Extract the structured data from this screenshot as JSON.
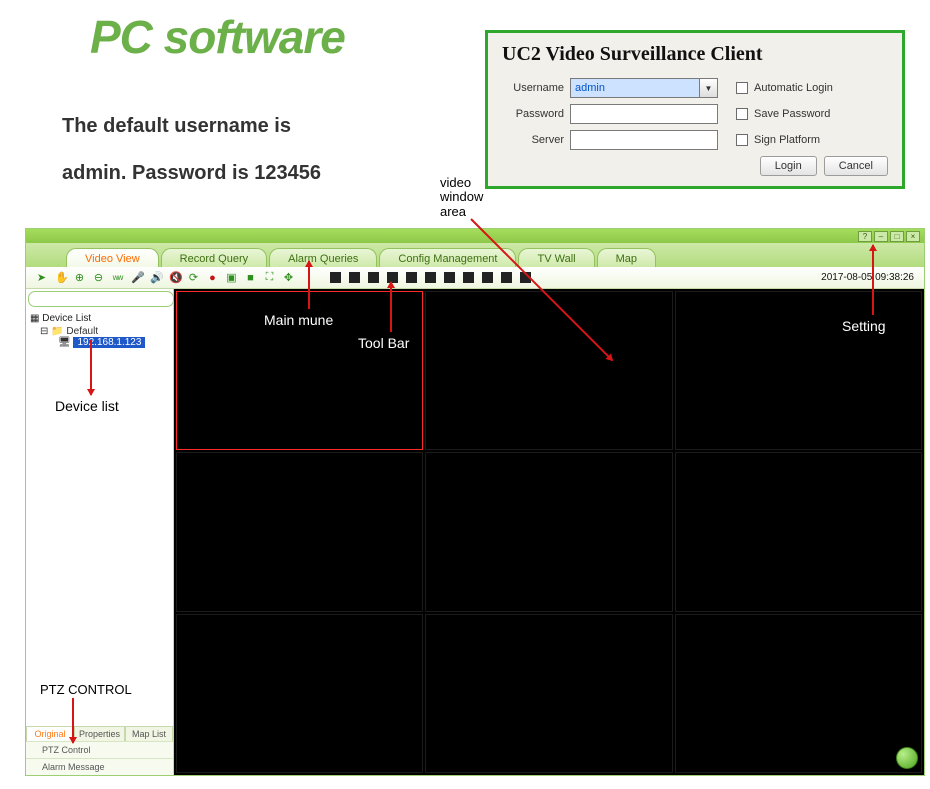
{
  "heading": "PC software",
  "subtext_line1": "The default username is",
  "subtext_line2": "admin. Password is 123456",
  "login": {
    "title": "UC2 Video Surveillance Client",
    "username_label": "Username",
    "password_label": "Password",
    "server_label": "Server",
    "username_value": "admin",
    "password_value": "",
    "server_value": "",
    "auto_login": "Automatic Login",
    "save_password": "Save Password",
    "sign_platform": "Sign Platform",
    "login_btn": "Login",
    "cancel_btn": "Cancel"
  },
  "tabs": {
    "video_view": "Video View",
    "record_query": "Record Query",
    "alarm_queries": "Alarm Queries",
    "config_mgmt": "Config Management",
    "tv_wall": "TV Wall",
    "map": "Map"
  },
  "toolbar": {
    "timestamp": "2017-08-05 09:38:26"
  },
  "sidebar": {
    "device_list_label": "Device List",
    "default_label": "Default",
    "selected_device": "192.168.1.123",
    "bottom_tabs": {
      "original": "Original",
      "properties": "Properties",
      "map_list": "Map List"
    },
    "footer": {
      "ptz": "PTZ Control",
      "alarm": "Alarm Message"
    }
  },
  "annotations": {
    "video_window_area": "video\nwindow\narea",
    "main_menu": "Main mune",
    "tool_bar": "Tool Bar",
    "setting": "Setting",
    "device_list": "Device list",
    "ptz_control": "PTZ CONTROL"
  },
  "win_controls": {
    "help": "?",
    "min": "–",
    "max": "□",
    "close": "×"
  }
}
